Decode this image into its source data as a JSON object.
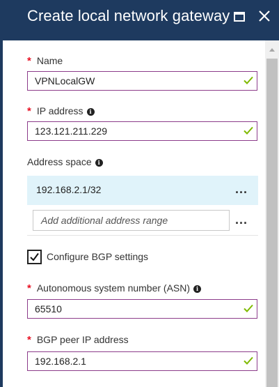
{
  "blade": {
    "title": "Create local network gateway"
  },
  "form": {
    "name": {
      "required_mark": "*",
      "label": "Name",
      "value": "VPNLocalGW"
    },
    "ip_address": {
      "required_mark": "*",
      "label": "IP address",
      "value": "123.121.211.229"
    },
    "address_space": {
      "label": "Address space",
      "entries": [
        "192.168.2.1/32"
      ],
      "add_placeholder": "Add additional address range",
      "more_label": "..."
    },
    "bgp": {
      "label": "Configure BGP settings",
      "checked": true
    },
    "asn": {
      "required_mark": "*",
      "label": "Autonomous system number (ASN)",
      "value": "65510"
    },
    "bgp_peer_ip": {
      "required_mark": "*",
      "label": "BGP peer IP address",
      "value": "192.168.2.1"
    }
  },
  "icons": {
    "info": "i",
    "valid": "check-icon",
    "maximize": "maximize-icon",
    "close": "close-icon"
  },
  "colors": {
    "titlebar": "#1e3a5f",
    "required": "#e81123",
    "input_border": "#8c3b8a",
    "valid_check": "#7fba00",
    "selected_row": "#e0f3fa"
  }
}
